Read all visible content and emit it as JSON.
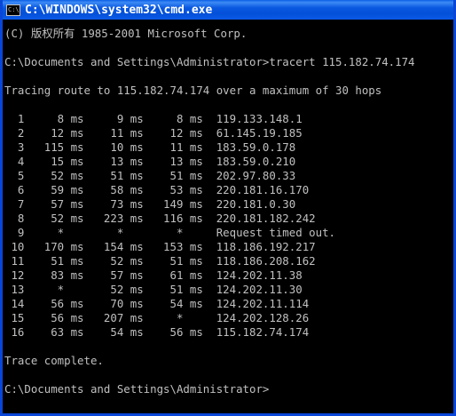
{
  "window": {
    "title": "C:\\WINDOWS\\system32\\cmd.exe",
    "icon_label": "C:\\"
  },
  "console": {
    "lines": [
      "(C) 版权所有 1985-2001 Microsoft Corp.",
      "",
      "C:\\Documents and Settings\\Administrator>tracert 115.182.74.174",
      "",
      "Tracing route to 115.182.74.174 over a maximum of 30 hops",
      "",
      "  1     8 ms     9 ms     8 ms  119.133.148.1",
      "  2    12 ms    11 ms    12 ms  61.145.19.185",
      "  3   115 ms    10 ms    11 ms  183.59.0.178",
      "  4    15 ms    13 ms    13 ms  183.59.0.210",
      "  5    52 ms    51 ms    51 ms  202.97.80.33",
      "  6    59 ms    58 ms    53 ms  220.181.16.170",
      "  7    57 ms    73 ms   149 ms  220.181.0.30",
      "  8    52 ms   223 ms   116 ms  220.181.182.242",
      "  9     *        *        *     Request timed out.",
      " 10   170 ms   154 ms   153 ms  118.186.192.217",
      " 11    51 ms    52 ms    51 ms  118.186.208.162",
      " 12    83 ms    57 ms    61 ms  124.202.11.38",
      " 13     *       52 ms    51 ms  124.202.11.30",
      " 14    56 ms    70 ms    54 ms  124.202.11.114",
      " 15    56 ms   207 ms     *     124.202.128.26",
      " 16    63 ms    54 ms    56 ms  115.182.74.174",
      "",
      "Trace complete.",
      "",
      "C:\\Documents and Settings\\Administrator>"
    ]
  }
}
